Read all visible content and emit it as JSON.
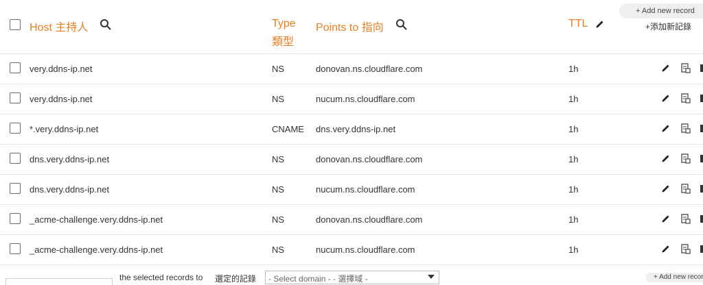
{
  "header": {
    "host_label": "Host 主持人",
    "type_label": "Type",
    "type_label_zh": "類型",
    "points_label": "Points to 指向",
    "ttl_label": "TTL",
    "add_button_label": "+ Add new record",
    "add_label_zh": "+添加新記錄"
  },
  "rows": [
    {
      "host": "very.ddns-ip.net",
      "type": "NS",
      "points_to": "donovan.ns.cloudflare.com",
      "ttl": "1h"
    },
    {
      "host": "very.ddns-ip.net",
      "type": "NS",
      "points_to": "nucum.ns.cloudflare.com",
      "ttl": "1h"
    },
    {
      "host": "*.very.ddns-ip.net",
      "type": "CNAME",
      "points_to": "dns.very.ddns-ip.net",
      "ttl": "1h"
    },
    {
      "host": "dns.very.ddns-ip.net",
      "type": "NS",
      "points_to": "donovan.ns.cloudflare.com",
      "ttl": "1h"
    },
    {
      "host": "dns.very.ddns-ip.net",
      "type": "NS",
      "points_to": "nucum.ns.cloudflare.com",
      "ttl": "1h"
    },
    {
      "host": "_acme-challenge.very.ddns-ip.net",
      "type": "NS",
      "points_to": "donovan.ns.cloudflare.com",
      "ttl": "1h"
    },
    {
      "host": "_acme-challenge.very.ddns-ip.net",
      "type": "NS",
      "points_to": "nucum.ns.cloudflare.com",
      "ttl": "1h"
    }
  ],
  "footer": {
    "selected_text": "the selected records to",
    "selected_text_zh": "選定的記錄",
    "domain_select_value": "- Select domain - - 選擇域 -",
    "add_button_label": "+ Add new record"
  },
  "colors": {
    "accent": "#e67e22",
    "border": "#e6e6e6",
    "text": "#333333"
  },
  "icons": {
    "search": "magnifier",
    "edit": "pencil",
    "copy": "document-copy",
    "delete": "trash"
  }
}
